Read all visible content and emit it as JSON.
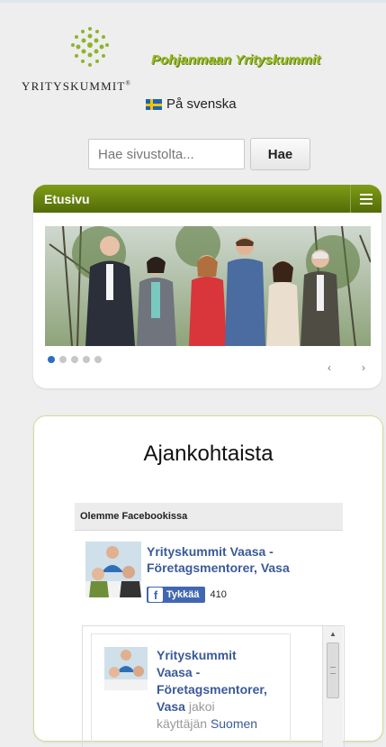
{
  "header": {
    "logo_text": "YRITYSKUMMIT",
    "logo_reg": "®",
    "tagline": "Pohjanmaan Yrityskummit",
    "language_link": "På svenska"
  },
  "search": {
    "placeholder": "Hae sivustolta...",
    "button_label": "Hae"
  },
  "slider": {
    "title": "Etusivu",
    "prev": "‹",
    "next": "›",
    "dot_count": 5,
    "active_dot": 1
  },
  "news": {
    "title": "Ajankohtaista"
  },
  "facebook": {
    "header": "Olemme Facebookissa",
    "page_name": "Yrityskummit Vaasa - Företagsmentorer, Vasa",
    "like_label": "Tykkää",
    "like_count": "410",
    "post_line1": "Yrityskummit",
    "post_line2": "Vaasa -",
    "post_line3": "Företagsmentorer,",
    "post_line4": "Vasa",
    "post_shared": "jakoi",
    "post_user": "käyttäjän",
    "post_link": "Suomen"
  },
  "colors": {
    "brand_green": "#9bbf2a",
    "bar_green": "#5f7b12",
    "facebook_blue": "#3b5998",
    "active_dot": "#2c6fc2"
  }
}
